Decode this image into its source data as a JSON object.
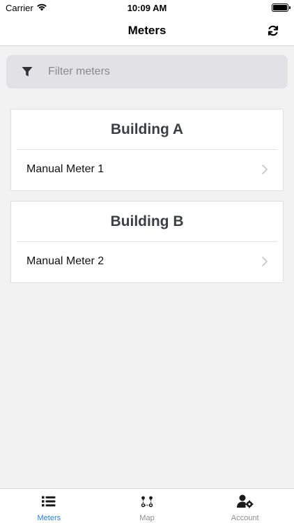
{
  "status_bar": {
    "carrier": "Carrier",
    "time": "10:09 AM"
  },
  "nav": {
    "title": "Meters"
  },
  "filter": {
    "placeholder": "Filter meters",
    "value": ""
  },
  "groups": [
    {
      "title": "Building A",
      "items": [
        {
          "label": "Manual Meter 1"
        }
      ]
    },
    {
      "title": "Building B",
      "items": [
        {
          "label": "Manual Meter 2"
        }
      ]
    }
  ],
  "tabs": [
    {
      "label": "Meters",
      "icon": "list-icon",
      "active": true
    },
    {
      "label": "Map",
      "icon": "route-icon",
      "active": false
    },
    {
      "label": "Account",
      "icon": "user-gear-icon",
      "active": false
    }
  ],
  "colors": {
    "accent": "#2a7de1",
    "heading": "#3a3f44",
    "filter_bg": "#e1e1e6",
    "background": "#f2f2f2"
  }
}
